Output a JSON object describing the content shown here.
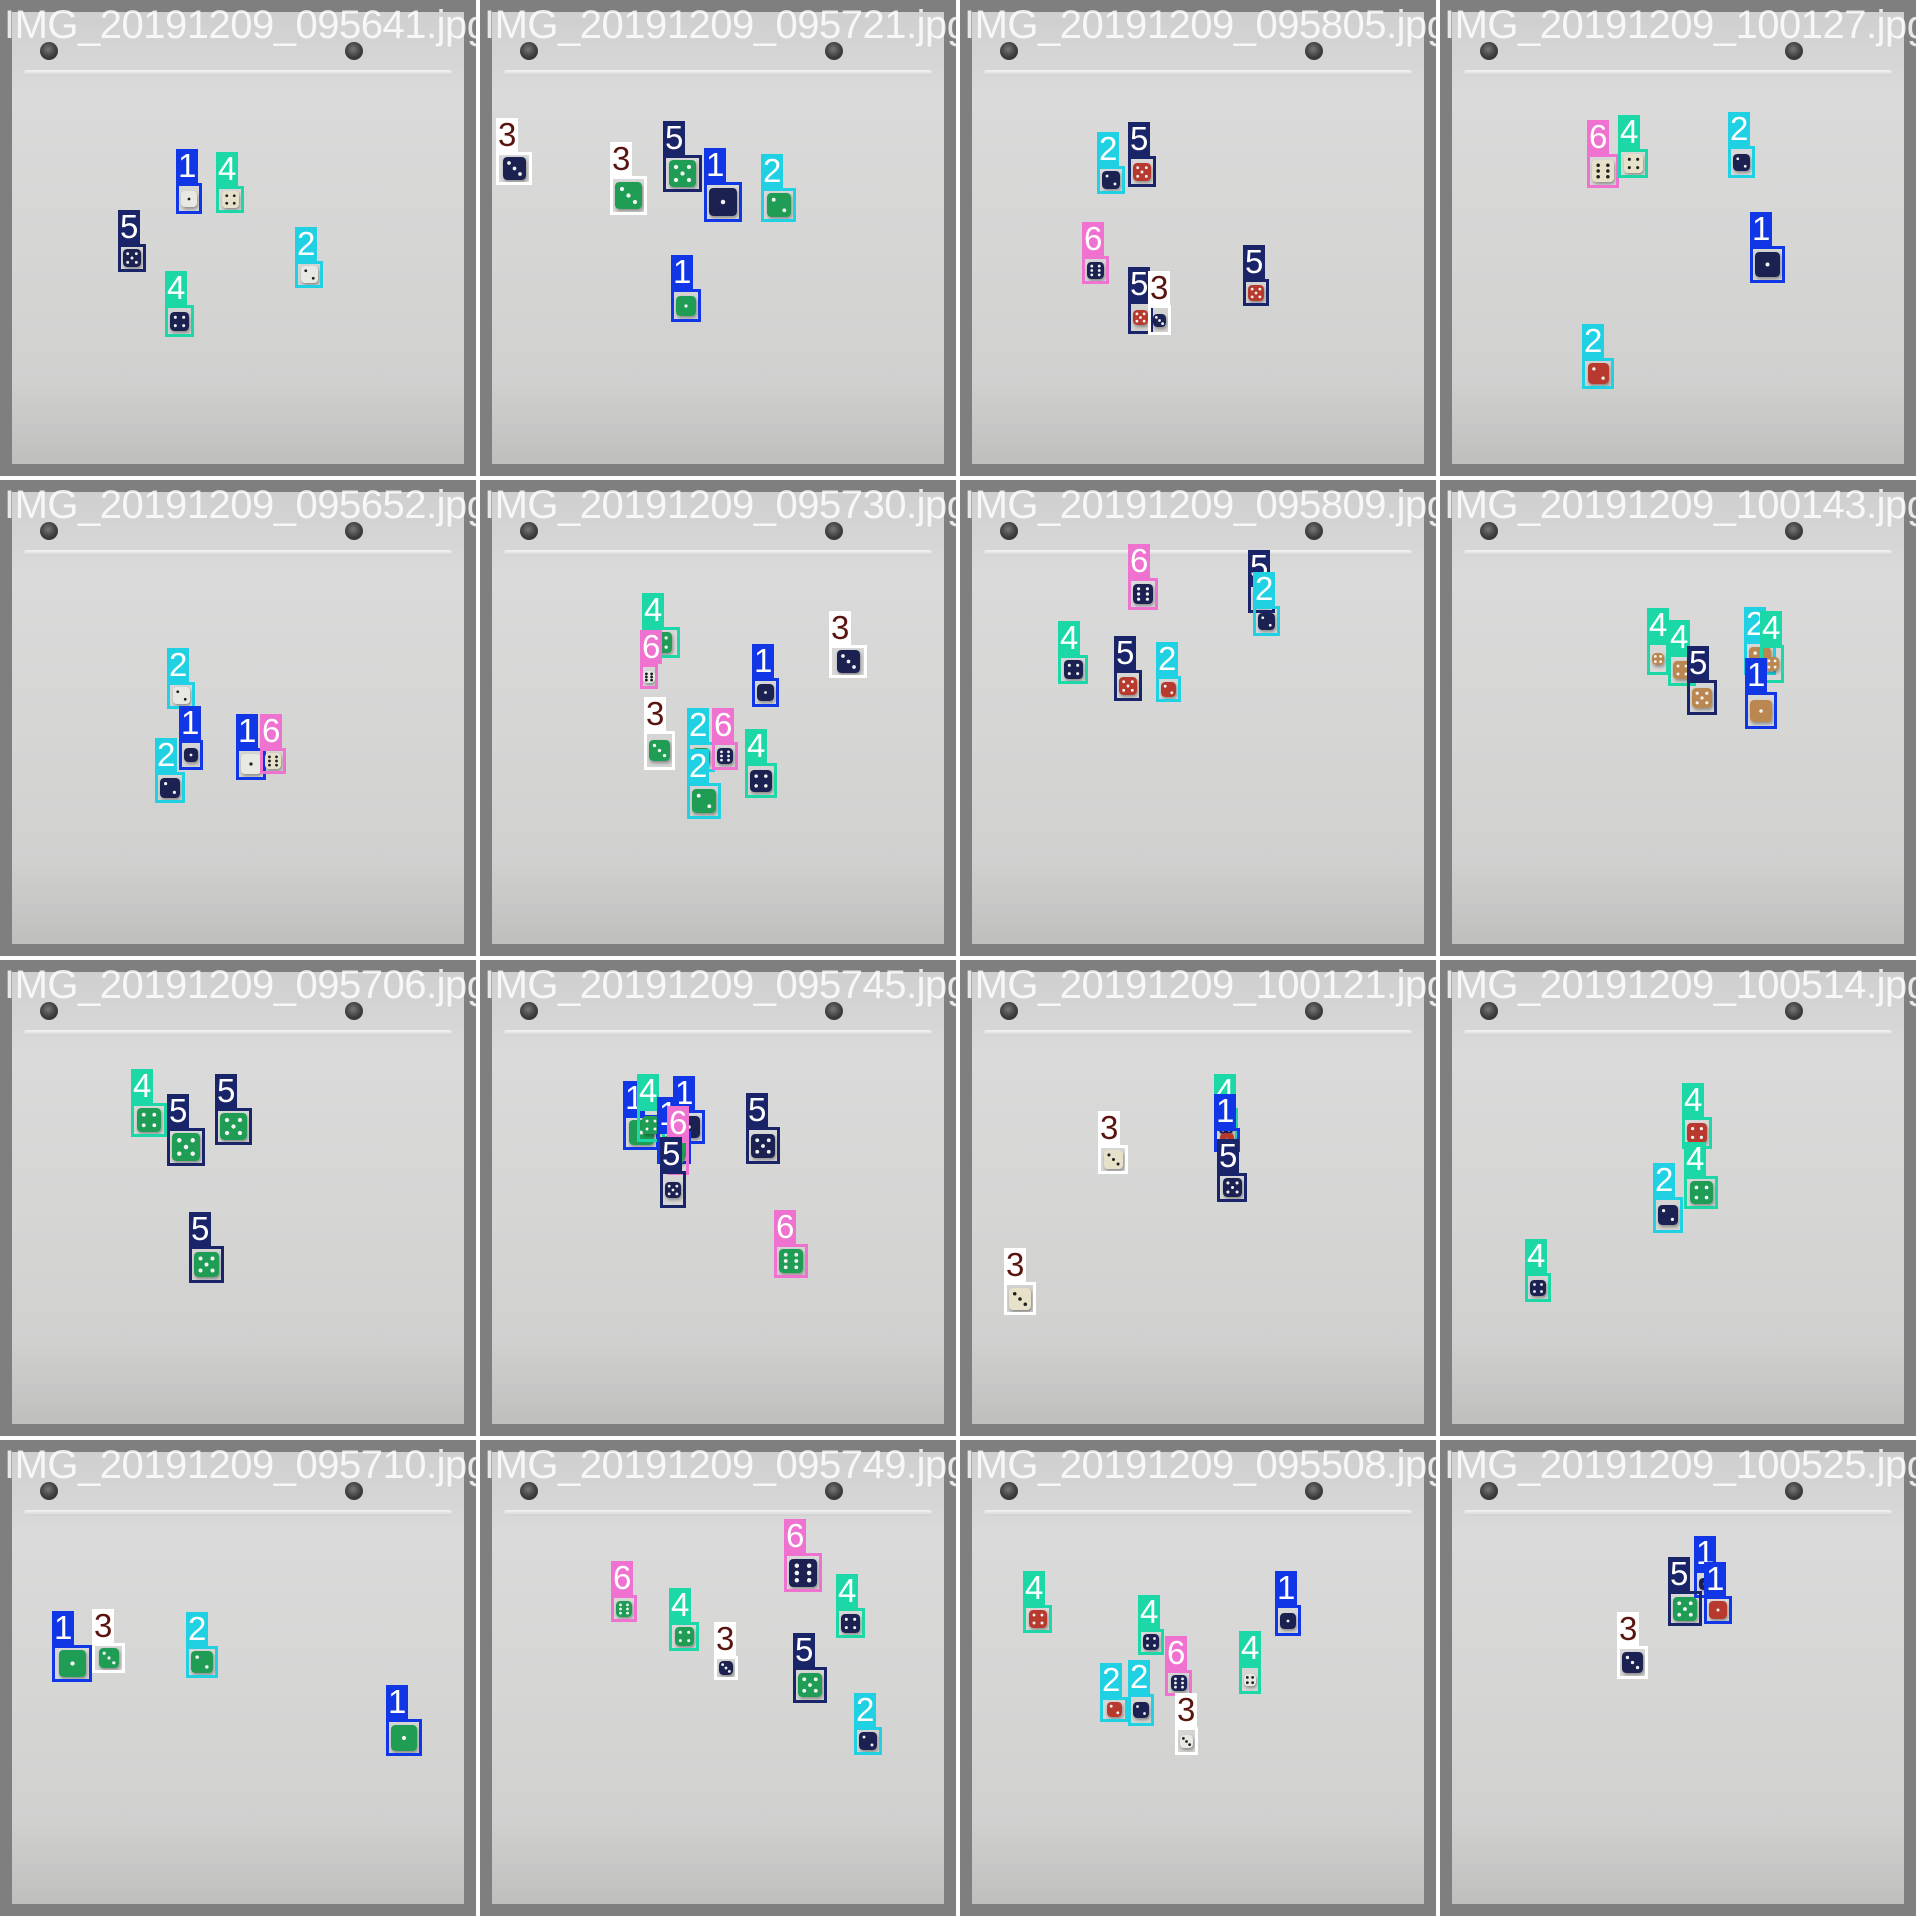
{
  "class_styles": {
    "1": {
      "color": "#1136e6",
      "text": "#ffffff"
    },
    "2": {
      "color": "#1fd1e3",
      "text": "#ffffff"
    },
    "3": {
      "color": "#ffffff",
      "text": "#5a1410"
    },
    "4": {
      "color": "#1cd8a6",
      "text": "#ffffff"
    },
    "5": {
      "color": "#1a2468",
      "text": "#ffffff"
    },
    "6": {
      "color": "#f072d0",
      "text": "#ffffff"
    }
  },
  "dice_colors": {
    "white": "#e9e9e4",
    "navy": "#1b2150",
    "green": "#1f9d55",
    "red": "#b83a2e",
    "tan": "#b9874f",
    "cream": "#e6e1c8"
  },
  "tiles": [
    {
      "title": "IMG_20191209_095641.jpg",
      "detections": [
        {
          "label": "1",
          "dice": "white"
        },
        {
          "label": "4",
          "dice": "cream"
        },
        {
          "label": "5",
          "dice": "navy"
        },
        {
          "label": "2",
          "dice": "white"
        },
        {
          "label": "4",
          "dice": "navy"
        }
      ]
    },
    {
      "title": "IMG_20191209_095721.jpg",
      "detections": [
        {
          "label": "3",
          "dice": "navy"
        },
        {
          "label": "3",
          "dice": "green"
        },
        {
          "label": "5",
          "dice": "green"
        },
        {
          "label": "1",
          "dice": "navy"
        },
        {
          "label": "2",
          "dice": "green"
        },
        {
          "label": "1",
          "dice": "green"
        }
      ]
    },
    {
      "title": "IMG_20191209_095805.jpg",
      "detections": [
        {
          "label": "2",
          "dice": "navy"
        },
        {
          "label": "5",
          "dice": "red"
        },
        {
          "label": "6",
          "dice": "navy"
        },
        {
          "label": "5",
          "dice": "red"
        },
        {
          "label": "3",
          "dice": "navy"
        },
        {
          "label": "5",
          "dice": "red"
        }
      ]
    },
    {
      "title": "IMG_20191209_100127.jpg",
      "detections": [
        {
          "label": "6",
          "dice": "cream"
        },
        {
          "label": "4",
          "dice": "cream"
        },
        {
          "label": "2",
          "dice": "navy"
        },
        {
          "label": "1",
          "dice": "navy"
        },
        {
          "label": "2",
          "dice": "red"
        }
      ]
    },
    {
      "title": "IMG_20191209_095652.jpg",
      "detections": [
        {
          "label": "2",
          "dice": "white"
        },
        {
          "label": "1",
          "dice": "navy"
        },
        {
          "label": "2",
          "dice": "navy"
        },
        {
          "label": "1",
          "dice": "white"
        },
        {
          "label": "6",
          "dice": "cream"
        }
      ]
    },
    {
      "title": "IMG_20191209_095730.jpg",
      "detections": [
        {
          "label": "4",
          "dice": "green"
        },
        {
          "label": "6",
          "dice": "white"
        },
        {
          "label": "3",
          "dice": "green"
        },
        {
          "label": "1",
          "dice": "navy"
        },
        {
          "label": "3",
          "dice": "navy"
        },
        {
          "label": "2",
          "dice": "green"
        },
        {
          "label": "6",
          "dice": "navy"
        },
        {
          "label": "4",
          "dice": "navy"
        },
        {
          "label": "2",
          "dice": "green"
        }
      ]
    },
    {
      "title": "IMG_20191209_095809.jpg",
      "detections": [
        {
          "label": "6",
          "dice": "navy"
        },
        {
          "label": "5",
          "dice": "red"
        },
        {
          "label": "2",
          "dice": "navy"
        },
        {
          "label": "4",
          "dice": "navy"
        },
        {
          "label": "5",
          "dice": "red"
        },
        {
          "label": "2",
          "dice": "red"
        }
      ]
    },
    {
      "title": "IMG_20191209_100143.jpg",
      "detections": [
        {
          "label": "4",
          "dice": "tan"
        },
        {
          "label": "4",
          "dice": "tan"
        },
        {
          "label": "2",
          "dice": "tan"
        },
        {
          "label": "4",
          "dice": "tan"
        },
        {
          "label": "5",
          "dice": "tan"
        },
        {
          "label": "1",
          "dice": "tan"
        }
      ]
    },
    {
      "title": "IMG_20191209_095706.jpg",
      "detections": [
        {
          "label": "4",
          "dice": "green"
        },
        {
          "label": "5",
          "dice": "green"
        },
        {
          "label": "5",
          "dice": "green"
        },
        {
          "label": "5",
          "dice": "green"
        }
      ]
    },
    {
      "title": "IMG_20191209_095745.jpg",
      "detections": [
        {
          "label": "1",
          "dice": "green"
        },
        {
          "label": "4",
          "dice": "green"
        },
        {
          "label": "1",
          "dice": "navy"
        },
        {
          "label": "1",
          "dice": "green"
        },
        {
          "label": "6",
          "dice": "green"
        },
        {
          "label": "5",
          "dice": "navy"
        },
        {
          "label": "5",
          "dice": "navy"
        },
        {
          "label": "6",
          "dice": "green"
        }
      ]
    },
    {
      "title": "IMG_20191209_100121.jpg",
      "detections": [
        {
          "label": "3",
          "dice": "cream"
        },
        {
          "label": "4",
          "dice": "navy"
        },
        {
          "label": "1",
          "dice": "red"
        },
        {
          "label": "5",
          "dice": "navy"
        },
        {
          "label": "3",
          "dice": "cream"
        }
      ]
    },
    {
      "title": "IMG_20191209_100514.jpg",
      "detections": [
        {
          "label": "4",
          "dice": "red"
        },
        {
          "label": "4",
          "dice": "green"
        },
        {
          "label": "2",
          "dice": "navy"
        },
        {
          "label": "4",
          "dice": "navy"
        }
      ]
    },
    {
      "title": "IMG_20191209_095710.jpg",
      "detections": [
        {
          "label": "1",
          "dice": "green"
        },
        {
          "label": "3",
          "dice": "green"
        },
        {
          "label": "2",
          "dice": "green"
        },
        {
          "label": "1",
          "dice": "green"
        }
      ]
    },
    {
      "title": "IMG_20191209_095749.jpg",
      "detections": [
        {
          "label": "6",
          "dice": "green"
        },
        {
          "label": "6",
          "dice": "navy"
        },
        {
          "label": "4",
          "dice": "navy"
        },
        {
          "label": "4",
          "dice": "green"
        },
        {
          "label": "3",
          "dice": "navy"
        },
        {
          "label": "5",
          "dice": "green"
        },
        {
          "label": "2",
          "dice": "navy"
        }
      ]
    },
    {
      "title": "IMG_20191209_095508.jpg",
      "detections": [
        {
          "label": "4",
          "dice": "red"
        },
        {
          "label": "1",
          "dice": "navy"
        },
        {
          "label": "4",
          "dice": "navy"
        },
        {
          "label": "6",
          "dice": "navy"
        },
        {
          "label": "4",
          "dice": "white"
        },
        {
          "label": "2",
          "dice": "red"
        },
        {
          "label": "2",
          "dice": "navy"
        },
        {
          "label": "3",
          "dice": "white"
        }
      ]
    },
    {
      "title": "IMG_20191209_100525.jpg",
      "detections": [
        {
          "label": "1",
          "dice": "navy"
        },
        {
          "label": "5",
          "dice": "green"
        },
        {
          "label": "1",
          "dice": "red"
        },
        {
          "label": "3",
          "dice": "navy"
        }
      ]
    }
  ]
}
